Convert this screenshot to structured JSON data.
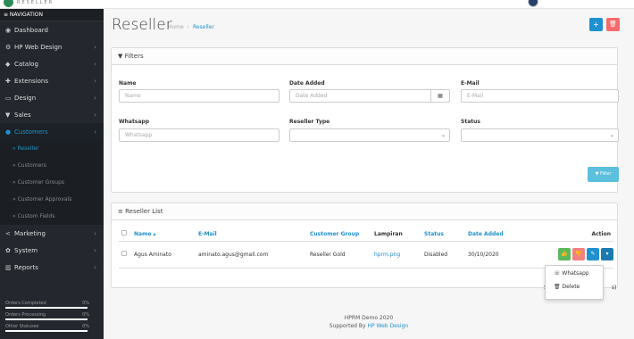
{
  "brand": {
    "text": "RESELLER"
  },
  "sidebar": {
    "header": "≡ NAVIGATION",
    "items": [
      {
        "label": "Dashboard",
        "icon": "dashboard-icon",
        "glyph": "◉",
        "chevron": ""
      },
      {
        "label": "HP Web Design",
        "icon": "cogs-icon",
        "glyph": "⚙",
        "chevron": "›"
      },
      {
        "label": "Catalog",
        "icon": "tag-icon",
        "glyph": "◆",
        "chevron": "›"
      },
      {
        "label": "Extensions",
        "icon": "puzzle-icon",
        "glyph": "✚",
        "chevron": "›"
      },
      {
        "label": "Design",
        "icon": "monitor-icon",
        "glyph": "▭",
        "chevron": "›"
      },
      {
        "label": "Sales",
        "icon": "cart-icon",
        "glyph": "▼",
        "chevron": "›"
      },
      {
        "label": "Customers",
        "icon": "user-icon",
        "glyph": "●",
        "chevron": "›"
      }
    ],
    "subitems": [
      "» Reseller",
      "» Customers",
      "» Customer Groups",
      "» Customer Approvals",
      "» Custom Fields"
    ],
    "items2": [
      {
        "label": "Marketing",
        "icon": "share-icon",
        "glyph": "<",
        "chevron": "›"
      },
      {
        "label": "System",
        "icon": "gear-icon",
        "glyph": "✿",
        "chevron": "›"
      },
      {
        "label": "Reports",
        "icon": "bar-chart-icon",
        "glyph": "▥",
        "chevron": "›"
      }
    ],
    "stats": [
      {
        "label": "Orders Completed",
        "pct": "0%",
        "progress": 0
      },
      {
        "label": "Orders Processing",
        "pct": "0%",
        "progress": 0
      },
      {
        "label": "Other Statuses",
        "pct": "0%",
        "progress": 0
      }
    ]
  },
  "page": {
    "title": "Reseller",
    "breadcrumb_home": "Home",
    "breadcrumb_sep": "›",
    "breadcrumb_current": "Reseller",
    "add_glyph": "+",
    "delete_glyph": "🗑"
  },
  "filters": {
    "title": "▼ Filters",
    "name_label": "Name",
    "name_placeholder": "Name",
    "date_label": "Date Added",
    "date_placeholder": "Date Added",
    "email_label": "E-Mail",
    "email_placeholder": "E-Mail",
    "whatsapp_label": "Whatsapp",
    "whatsapp_placeholder": "Whatsapp",
    "type_label": "Reseller Type",
    "type_value": "",
    "status_label": "Status",
    "status_value": "",
    "filter_button": "▼ Filter"
  },
  "list": {
    "title": "≡ Reseller List",
    "columns": [
      "Name ▴",
      "E-Mail",
      "Customer Group",
      "Lampiran",
      "Status",
      "Date Added",
      "Action"
    ],
    "rows": [
      {
        "name": "Agus Aminato",
        "email": "aminato.agus@gmail.com",
        "group": "Reseller Gold",
        "lampiran": "hprm.png",
        "status": "Disabled",
        "date": "30/10/2020"
      }
    ],
    "dropdown": {
      "whatsapp": "☏ Whatsapp",
      "delete": "🗑 Delete"
    },
    "pagination_fragment": "S",
    "pagination_fragment2": "s)"
  },
  "footer": {
    "line1": "HPRM Demo 2020",
    "line2_prefix": "Supported By ",
    "line2_link": "HP Web Design"
  },
  "colors": {
    "accent": "#1e91cf",
    "sidebar": "#24282e",
    "success": "#5cb85c",
    "danger": "#f56b6b",
    "info": "#5bc0de"
  }
}
